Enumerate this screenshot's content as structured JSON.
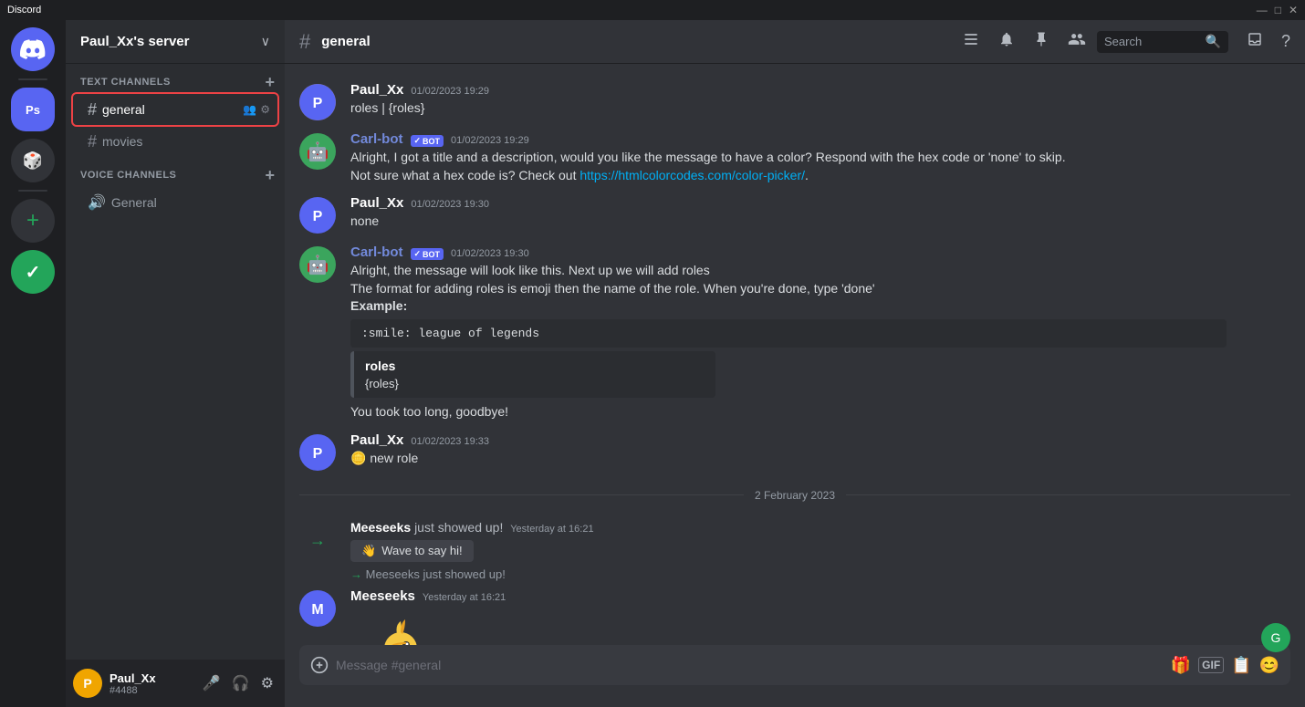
{
  "titlebar": {
    "title": "Discord",
    "minimize": "—",
    "maximize": "□",
    "close": "✕"
  },
  "server_sidebar": {
    "icons": [
      {
        "id": "discord",
        "label": "Discord",
        "type": "discord",
        "char": "🎮"
      },
      {
        "id": "server1",
        "label": "Ps server",
        "type": "purple",
        "char": "Ps"
      },
      {
        "id": "server2",
        "label": "Dark server",
        "type": "dark",
        "char": "🎲"
      },
      {
        "id": "server3",
        "label": "Green server",
        "type": "green",
        "char": "✓"
      }
    ],
    "add_label": "+"
  },
  "channel_sidebar": {
    "server_name": "Paul_Xx's server",
    "text_channels_label": "TEXT CHANNELS",
    "channels": [
      {
        "id": "general",
        "name": "general",
        "active": true
      },
      {
        "id": "movies",
        "name": "movies",
        "active": false
      }
    ],
    "voice_channels_label": "VOICE CHANNELS",
    "voice_channels": [
      {
        "id": "general-voice",
        "name": "General"
      }
    ]
  },
  "user_area": {
    "name": "Paul_Xx",
    "tag": "#4488",
    "avatar": "P",
    "mic_icon": "🎤",
    "headphone_icon": "🎧",
    "settings_icon": "⚙"
  },
  "chat_header": {
    "channel": "general",
    "icons": {
      "threads": "≡",
      "notifications": "🔔",
      "pin": "📌",
      "members": "👥",
      "search_placeholder": "Search",
      "inbox": "📥",
      "help": "?"
    }
  },
  "messages": [
    {
      "id": "msg1",
      "type": "message",
      "author": "Paul_Xx",
      "avatar": "P",
      "avatar_type": "orange",
      "timestamp": "01/02/2023 19:29",
      "text": "roles | {roles}"
    },
    {
      "id": "msg2",
      "type": "message",
      "author": "Carl-bot",
      "bot": true,
      "avatar_type": "carlbot",
      "timestamp": "01/02/2023 19:29",
      "lines": [
        "Alright, I got a title and a description, would you like the message to have a color? Respond with the hex code or 'none' to skip.",
        "Not sure what a hex code is? Check out "
      ],
      "link": "https://htmlcolorcodes.com/color-picker/",
      "link_text": "https://htmlcolorcodes.com/color-picker/"
    },
    {
      "id": "msg3",
      "type": "message",
      "author": "Paul_Xx",
      "avatar": "P",
      "avatar_type": "orange",
      "timestamp": "01/02/2023 19:30",
      "text": "none"
    },
    {
      "id": "msg4",
      "type": "message",
      "author": "Carl-bot",
      "bot": true,
      "avatar_type": "carlbot",
      "timestamp": "01/02/2023 19:30",
      "lines": [
        "Alright, the message will look like this. Next up we will add roles",
        "The format for adding roles is emoji then the name of the role. When you're done, type 'done'"
      ],
      "bold_line": "Example:",
      "code": ":smile: league of legends",
      "embed_title": "roles",
      "embed_desc": "{roles}",
      "extra_line": "You took too long, goodbye!"
    },
    {
      "id": "msg5",
      "type": "message",
      "author": "Paul_Xx",
      "avatar": "P",
      "avatar_type": "orange",
      "timestamp": "01/02/2023 19:33",
      "text": "🪙 new role"
    },
    {
      "id": "date_divider",
      "type": "divider",
      "text": "2 February 2023"
    },
    {
      "id": "msg6",
      "type": "system",
      "text_parts": [
        "Meeseeks",
        " just showed up! ",
        "Yesterday at 16:21"
      ],
      "wave_btn": "Wave to say hi!"
    },
    {
      "id": "msg7",
      "type": "message_with_system",
      "system_line": "→ Meeseeks just showed up!",
      "author": "Meeseeks",
      "avatar_type": "orange",
      "timestamp": "Yesterday at 16:21",
      "has_parrot": true
    }
  ],
  "message_input": {
    "placeholder": "Message #general"
  },
  "colors": {
    "accent": "#5865f2",
    "green": "#23a55a",
    "danger": "#ed4245",
    "text_primary": "#ffffff",
    "text_muted": "#949ba4",
    "bg_primary": "#313338",
    "bg_secondary": "#2b2d31",
    "bg_tertiary": "#1e1f22",
    "bg_input": "#383a40"
  }
}
